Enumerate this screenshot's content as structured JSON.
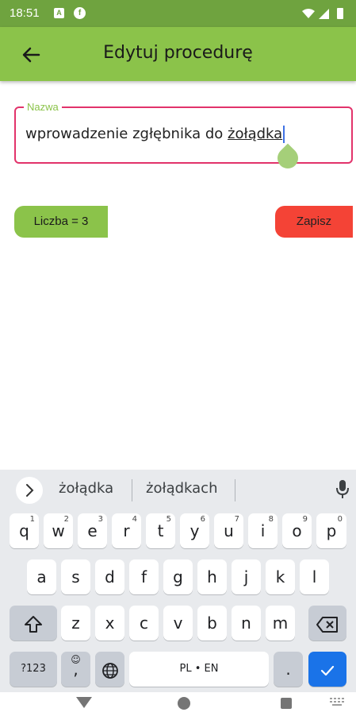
{
  "status_bar": {
    "time": "18:51",
    "icon_a": "A",
    "icon_f": "f"
  },
  "app_bar": {
    "title": "Edytuj procedurę",
    "back_icon": "arrow-left-icon"
  },
  "field": {
    "label": "Nazwa",
    "value_prefix": "wprowadzenie zgłębnika do ",
    "value_underlined": "żołądka",
    "border_color": "#e2336b",
    "label_color": "#8bc34a"
  },
  "count_chip": {
    "label": "Liczba = 3",
    "color": "#8bc34a"
  },
  "save_button": {
    "label": "Zapisz",
    "color": "#f44336"
  },
  "keyboard": {
    "suggestions": [
      "żołądka",
      "żołądkach"
    ],
    "row1": [
      "q",
      "w",
      "e",
      "r",
      "t",
      "y",
      "u",
      "i",
      "o",
      "p"
    ],
    "row1_hints": [
      "1",
      "2",
      "3",
      "4",
      "5",
      "6",
      "7",
      "8",
      "9",
      "0"
    ],
    "row2": [
      "a",
      "s",
      "d",
      "f",
      "g",
      "h",
      "j",
      "k",
      "l"
    ],
    "row3": [
      "z",
      "x",
      "c",
      "v",
      "b",
      "n",
      "m"
    ],
    "symbols_label": "?123",
    "comma_label": ",",
    "space_label": "PL • EN",
    "period_label": ".",
    "enter_color": "#1a73e8"
  },
  "theme": {
    "primary": "#8bc34a",
    "status": "#6fa33f"
  }
}
